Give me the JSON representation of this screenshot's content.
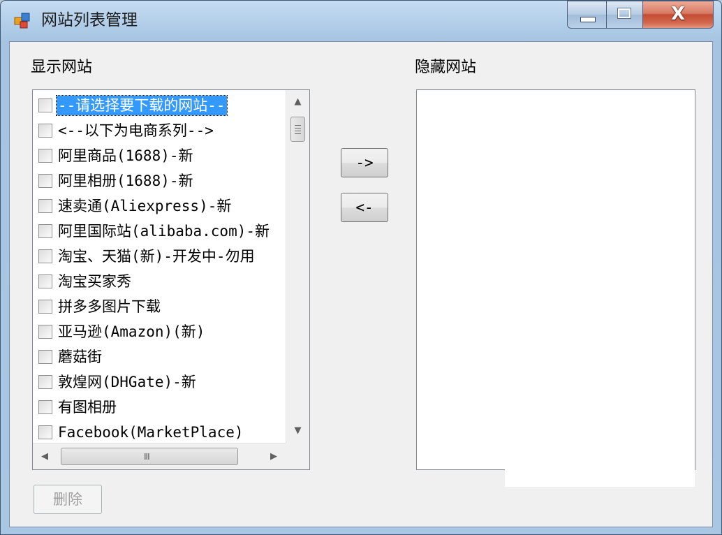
{
  "window": {
    "title": "网站列表管理",
    "close_glyph": "X"
  },
  "show_group": {
    "label": "显示网站",
    "items": [
      {
        "label": "--请选择要下载的网站--",
        "checked": false,
        "selected": true
      },
      {
        "label": "<--以下为电商系列-->",
        "checked": false,
        "selected": false
      },
      {
        "label": "阿里商品(1688)-新",
        "checked": false,
        "selected": false
      },
      {
        "label": "阿里相册(1688)-新",
        "checked": false,
        "selected": false
      },
      {
        "label": "速卖通(Aliexpress)-新",
        "checked": false,
        "selected": false
      },
      {
        "label": "阿里国际站(alibaba.com)-新",
        "checked": false,
        "selected": false
      },
      {
        "label": "淘宝、天猫(新)-开发中-勿用",
        "checked": false,
        "selected": false
      },
      {
        "label": "淘宝买家秀",
        "checked": false,
        "selected": false
      },
      {
        "label": "拼多多图片下载",
        "checked": false,
        "selected": false
      },
      {
        "label": "亚马逊(Amazon)(新)",
        "checked": false,
        "selected": false
      },
      {
        "label": "蘑菇街",
        "checked": false,
        "selected": false
      },
      {
        "label": "敦煌网(DHGate)-新",
        "checked": false,
        "selected": false
      },
      {
        "label": "有图相册",
        "checked": false,
        "selected": false
      },
      {
        "label": "Facebook(MarketPlace)",
        "checked": false,
        "selected": false
      }
    ]
  },
  "hidden_group": {
    "label": "隐藏网站",
    "items": []
  },
  "buttons": {
    "move_right": "->",
    "move_left": "<-",
    "delete": "删除"
  },
  "scrollbar": {
    "up_arrow": "▲",
    "down_arrow": "▼",
    "left_arrow": "◀",
    "right_arrow": "▶",
    "grip": "III"
  },
  "colors": {
    "selection": "#3399ff",
    "client_bg": "#f0f0f0",
    "close_button": "#c44c33"
  }
}
